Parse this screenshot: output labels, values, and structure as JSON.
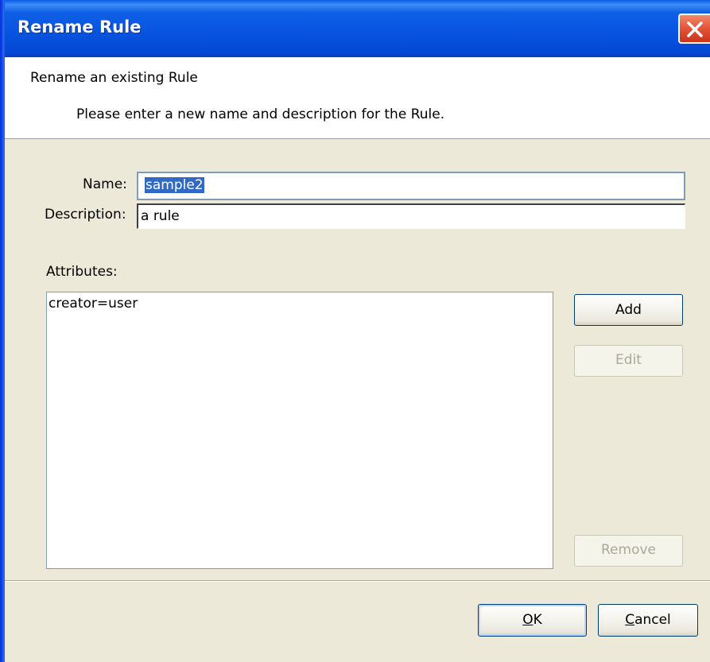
{
  "window": {
    "title": "Rename Rule",
    "close_icon": "close-icon"
  },
  "header": {
    "title": "Rename an existing Rule",
    "description": "Please enter a new name and description for the Rule."
  },
  "form": {
    "name_label": "Name:",
    "name_value": "sample2",
    "description_label": "Description:",
    "description_value": "a rule",
    "attributes_label": "Attributes:"
  },
  "attributes": {
    "items": [
      "creator=user"
    ]
  },
  "buttons": {
    "add": "Add",
    "edit": "Edit",
    "remove": "Remove",
    "ok_mnemonic": "O",
    "ok_rest": "K",
    "cancel_mnemonic": "C",
    "cancel_rest": "ancel"
  },
  "colors": {
    "titlebar": "#0753e0",
    "selection": "#316ac5",
    "dialog_bg": "#ece9d8"
  }
}
